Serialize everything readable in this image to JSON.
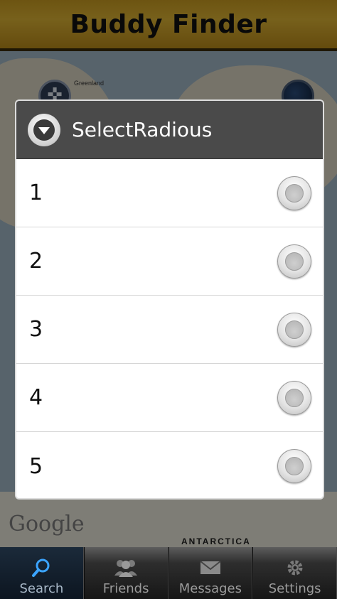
{
  "app": {
    "title": "Buddy Finder",
    "title_bar_color": "#d2a92e"
  },
  "map": {
    "labels": {
      "greenland": "Greenland",
      "antarctica": "ANTARCTICA",
      "google": "Google"
    }
  },
  "dialog": {
    "title": "SelectRadious",
    "header_icon": "chevron-down-circle-icon",
    "options": [
      {
        "label": "1",
        "selected": false
      },
      {
        "label": "2",
        "selected": false
      },
      {
        "label": "3",
        "selected": false
      },
      {
        "label": "4",
        "selected": false
      },
      {
        "label": "5",
        "selected": false
      }
    ]
  },
  "tabs": [
    {
      "label": "Search",
      "icon": "search-icon",
      "active": true
    },
    {
      "label": "Friends",
      "icon": "friends-icon",
      "active": false
    },
    {
      "label": "Messages",
      "icon": "envelope-icon",
      "active": false
    },
    {
      "label": "Settings",
      "icon": "gear-icon",
      "active": false
    }
  ],
  "colors": {
    "accent": "#3ba4ff",
    "dialog_header": "#4a4a4a"
  }
}
